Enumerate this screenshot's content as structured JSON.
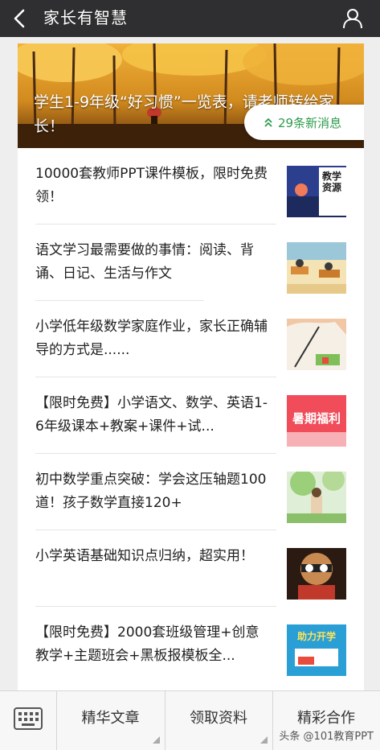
{
  "header": {
    "title": "家长有智慧",
    "back_icon": "back-arrow-icon",
    "user_icon": "user-icon"
  },
  "hero": {
    "caption": "学生1-9年级“好习惯”一览表，请老师转给家长！"
  },
  "notice": {
    "text": "29条新消息",
    "icon": "double-chevron-up-icon",
    "color": "#2e9b4d"
  },
  "articles": [
    {
      "title": "10000套教师PPT课件模板，限时免费领！",
      "thumb_text": "教学资源"
    },
    {
      "title": "语文学习最需要做的事情：阅读、背诵、日记、生活与作文"
    },
    {
      "title": "小学低年级数学家庭作业，家长正确辅导的方式是......"
    },
    {
      "title": "【限时免费】小学语文、数学、英语1-6年级课本+教案+课件+试...",
      "thumb_text": "暑期福利"
    },
    {
      "title": "初中数学重点突破：学会这压轴题100道！孩子数学直接120+"
    },
    {
      "title": "小学英语基础知识点归纳，超实用！"
    },
    {
      "title": "【限时免费】2000套班级管理+创意教学+主题班会+黑板报模板全...",
      "thumb_text": "助力开学"
    }
  ],
  "bottom_menu": {
    "keyboard_icon": "keyboard-icon",
    "items": [
      "精华文章",
      "领取资料",
      "精彩合作"
    ]
  },
  "watermark": "头条 @101教育PPT"
}
